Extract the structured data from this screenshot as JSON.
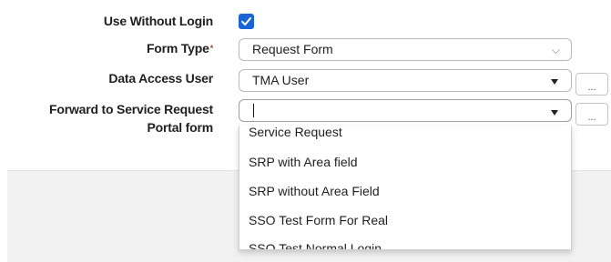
{
  "form": {
    "use_without_login": {
      "label": "Use Without Login",
      "checked": true
    },
    "form_type": {
      "label": "Form Type",
      "required_mark": "*",
      "value": "Request Form"
    },
    "data_access_user": {
      "label": "Data Access User",
      "value": "TMA User",
      "browse_label": "..."
    },
    "forward_to": {
      "label_line1": "Forward to Service Request",
      "label_line2": "Portal form",
      "value": "",
      "browse_label": "...",
      "options": [
        "Service Request",
        "SRP with Area field",
        "SRP without Area Field",
        "SSO Test Form For Real",
        "SSO Test Normal Login"
      ]
    }
  },
  "colors": {
    "checkbox": "#1a64d6",
    "required": "#c0392b"
  }
}
